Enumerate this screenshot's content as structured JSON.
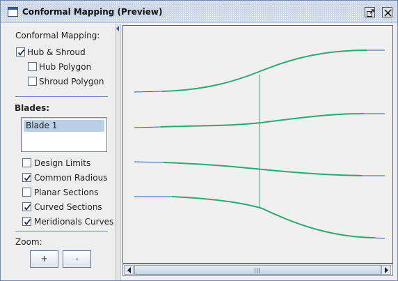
{
  "window": {
    "title": "Conformal Mapping (Preview)",
    "icons": [
      "window-app-icon",
      "undock-icon",
      "close-icon"
    ]
  },
  "left_panel": {
    "section_label": "Conformal Mapping:",
    "hub_shroud": {
      "label": "Hub & Shroud",
      "checked": true
    },
    "hub_polygon": {
      "label": "Hub Polygon",
      "checked": false
    },
    "shroud_polygon": {
      "label": "Shroud Polygon",
      "checked": false
    },
    "blades_label": "Blades:",
    "blades_list": [
      "Blade 1"
    ],
    "options": [
      {
        "label": "Design Limits",
        "checked": false
      },
      {
        "label": "Common Radious",
        "checked": true
      },
      {
        "label": "Planar Sections",
        "checked": false
      },
      {
        "label": "Curved Sections",
        "checked": true
      },
      {
        "label": "Meridionals Curves",
        "checked": true
      }
    ],
    "zoom_label": "Zoom:",
    "zoom_in_label": "+",
    "zoom_out_label": "-"
  },
  "colors": {
    "curve_green": "#2ea873",
    "extension_blue": "#2f5aa8",
    "title_bar": "#cdd9ea",
    "separator": "#6f89b2"
  }
}
